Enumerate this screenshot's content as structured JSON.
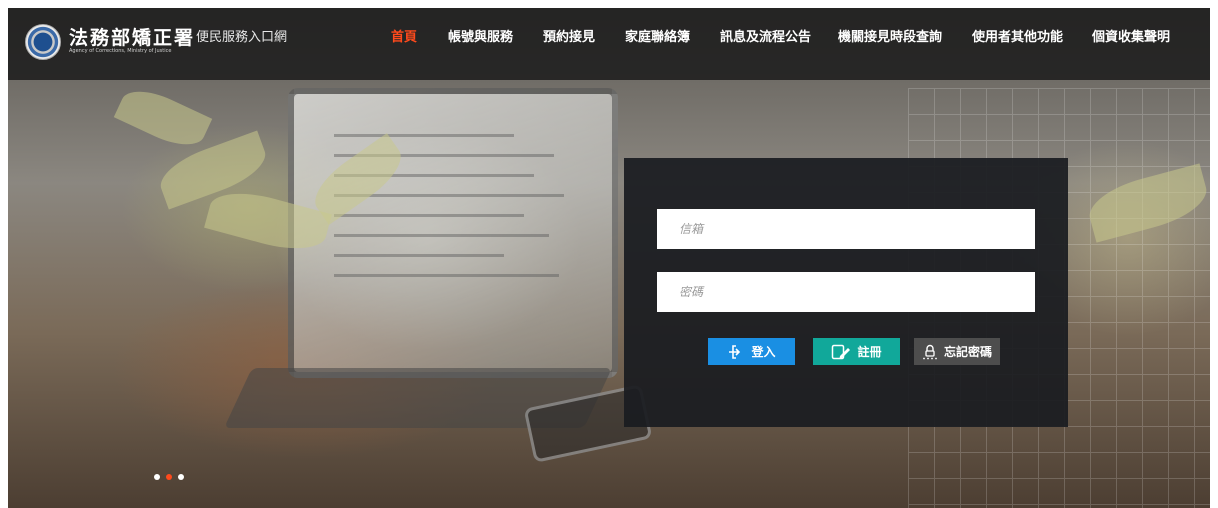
{
  "header": {
    "logo_title": "法務部矯正署",
    "logo_subtitle": "Agency of Corrections, Ministry of Justice",
    "site_name": "便民服務入口網"
  },
  "nav": {
    "items": [
      {
        "label": "首頁",
        "active": true
      },
      {
        "label": "帳號與服務",
        "active": false
      },
      {
        "label": "預約接見",
        "active": false
      },
      {
        "label": "家庭聯絡簿",
        "active": false
      },
      {
        "label": "訊息及流程公告",
        "active": false
      },
      {
        "label": "機關接見時段查詢",
        "active": false
      },
      {
        "label": "使用者其他功能",
        "active": false
      },
      {
        "label": "個資收集聲明",
        "active": false
      }
    ]
  },
  "login": {
    "email_placeholder": "信箱",
    "email_value": "",
    "password_placeholder": "密碼",
    "password_value": "",
    "login_label": "登入",
    "register_label": "註冊",
    "forgot_label": "忘記密碼"
  },
  "carousel": {
    "dot_count": 3,
    "active_index": 1
  },
  "colors": {
    "accent_active": "#ff4a1c",
    "login_button": "#1a8fe3",
    "register_button": "#11a89a",
    "forgot_button": "#4d4d4d",
    "panel_bg": "#1a1c20"
  },
  "icons": {
    "login": "sign-in-icon",
    "register": "register-edit-icon",
    "forgot": "lock-password-icon"
  }
}
